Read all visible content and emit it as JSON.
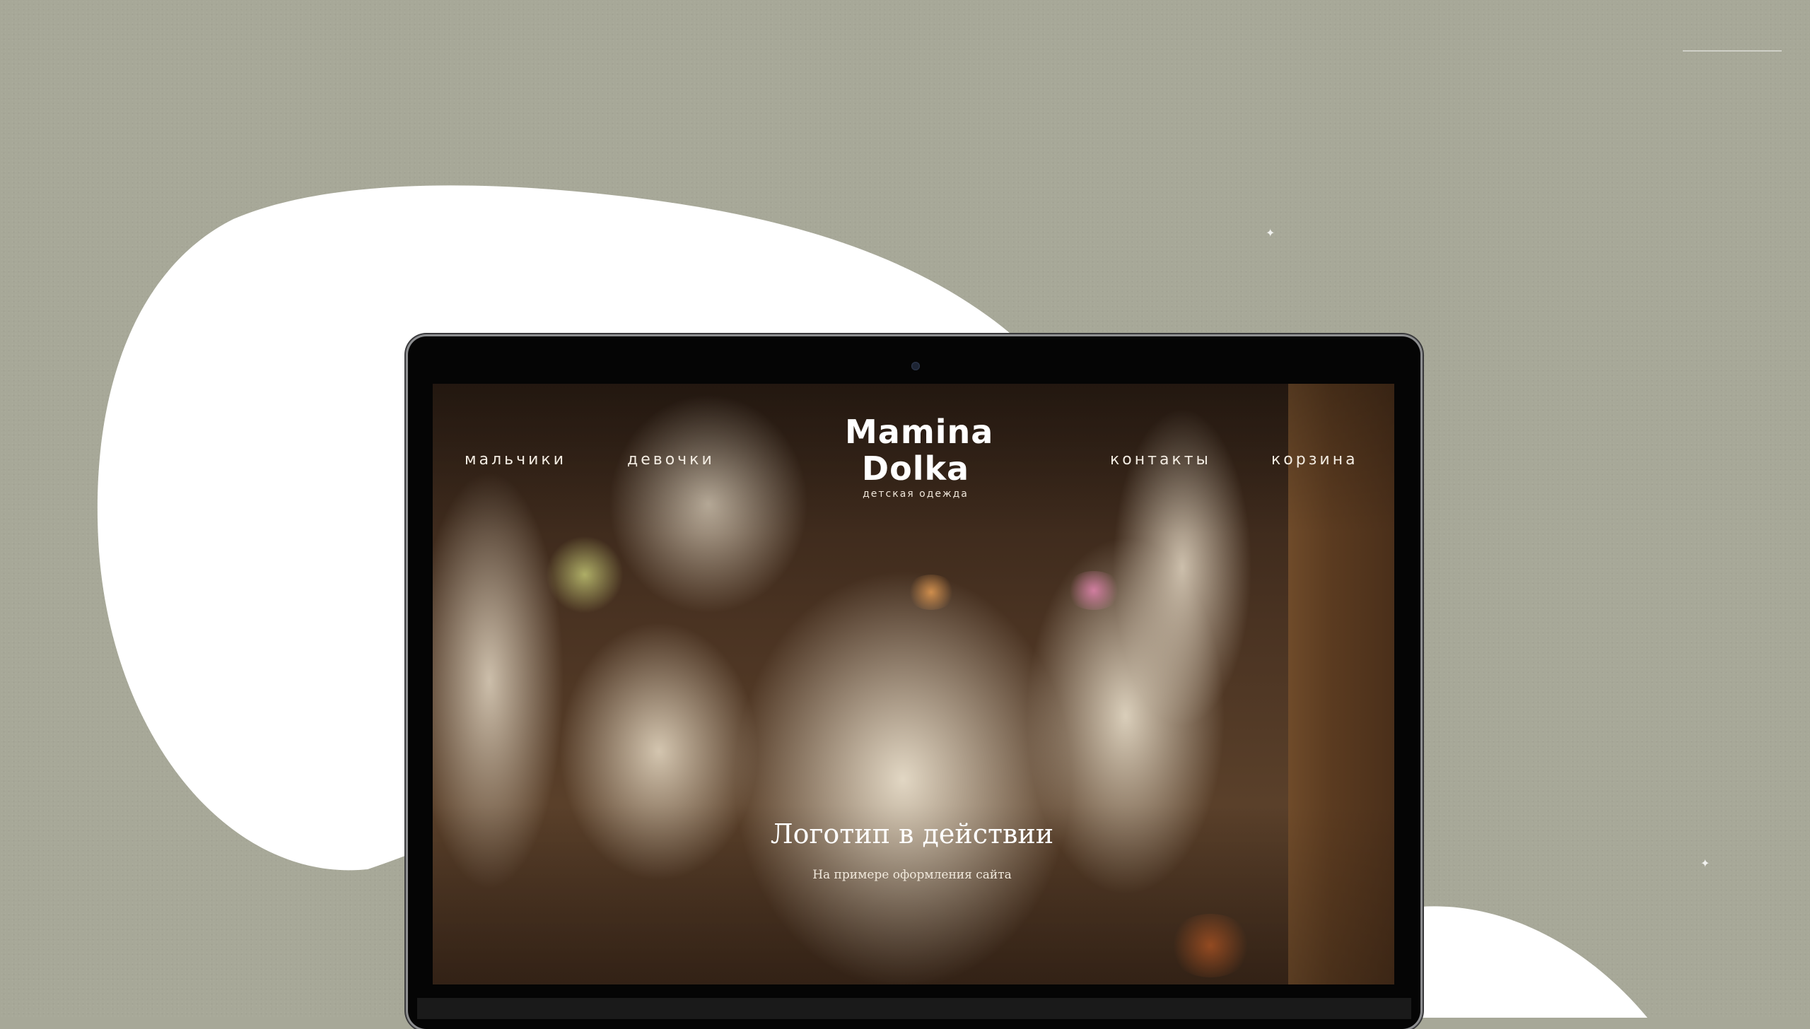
{
  "nav": {
    "left": [
      {
        "label": "мальчики"
      },
      {
        "label": "девочки"
      }
    ],
    "right": [
      {
        "label": "контакты"
      },
      {
        "label": "корзина"
      }
    ]
  },
  "logo": {
    "line1": "Mamina",
    "line2": "Dolka",
    "tagline": "детская одежда"
  },
  "hero": {
    "title": "Логотип в действии",
    "subtitle": "На примере оформления сайта"
  },
  "colors": {
    "background": "#a7a898",
    "blob": "#ffffff",
    "bezel": "#050505",
    "nav_text": "#f3ece2"
  },
  "icons": {
    "camera": "camera-dot-icon",
    "sparkles": "sparkle-icon"
  }
}
